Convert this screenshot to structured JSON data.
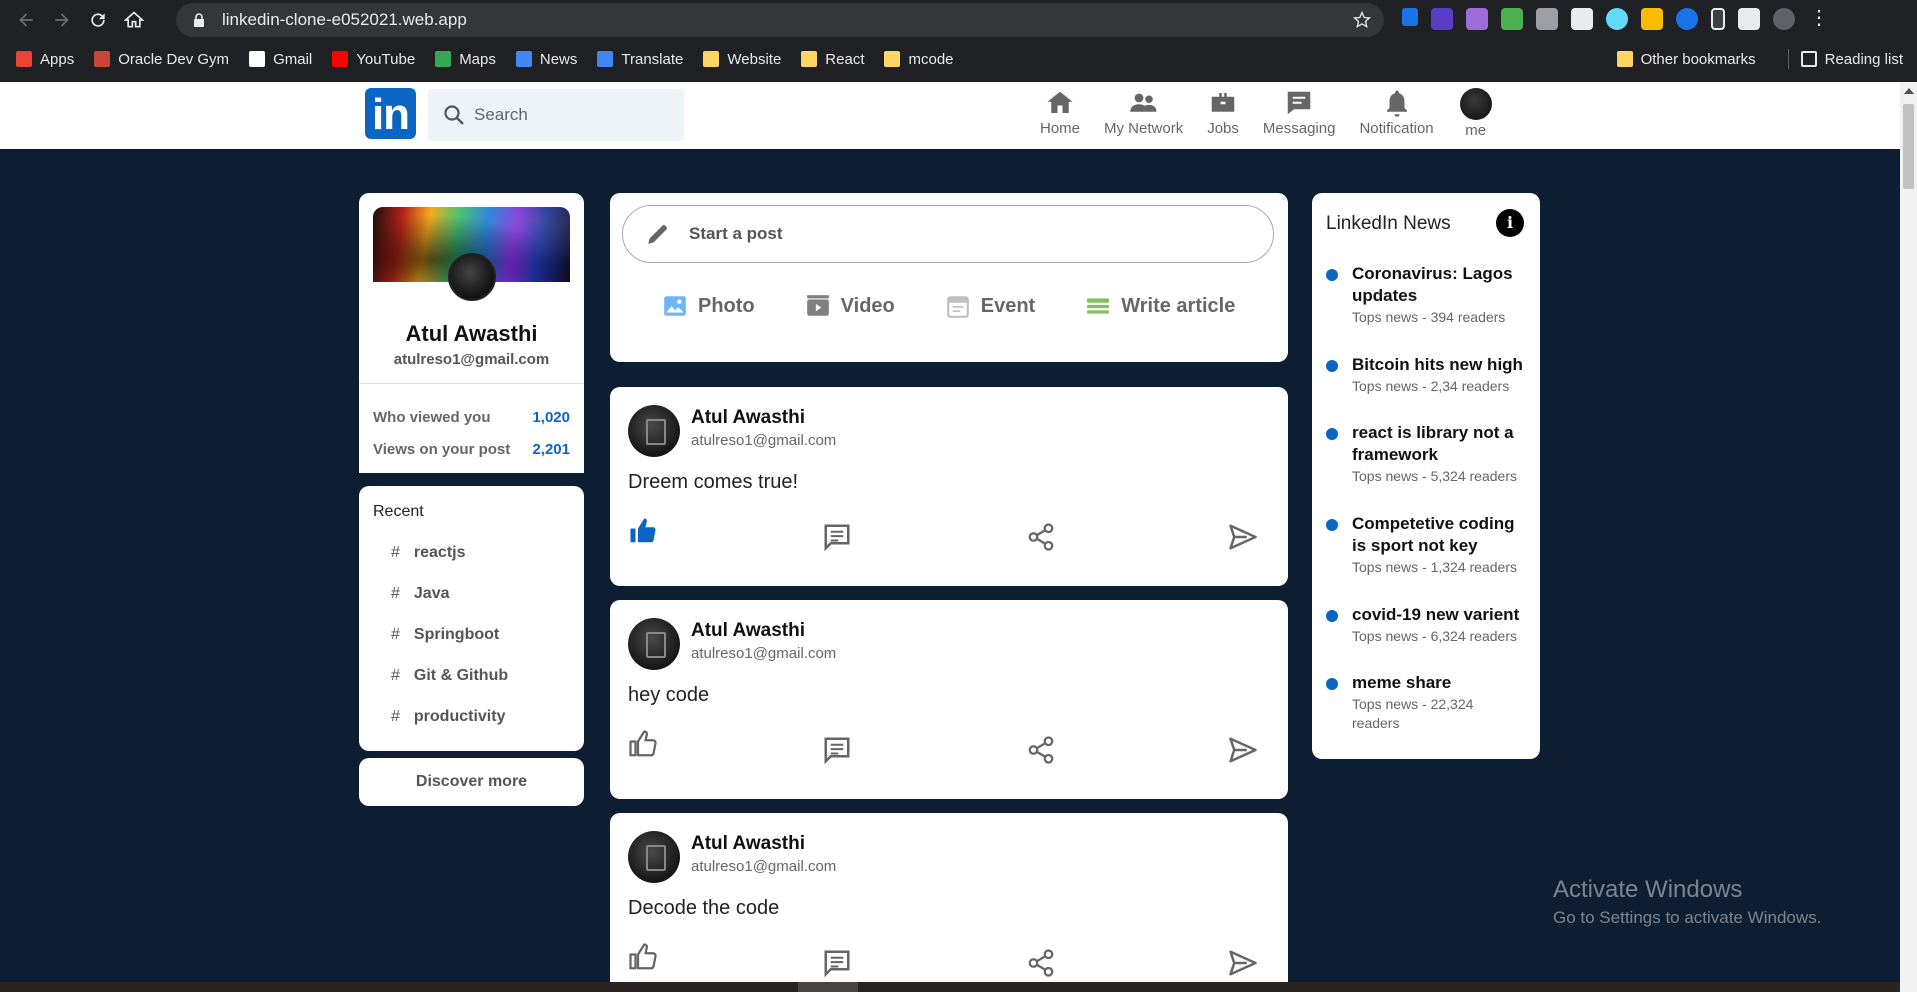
{
  "browser": {
    "url": "linkedin-clone-e052021.web.app",
    "bookmarks": [
      {
        "label": "Apps",
        "color": "#ea4335"
      },
      {
        "label": "Oracle Dev Gym",
        "color": "#c74634"
      },
      {
        "label": "Gmail",
        "color": "#ffffff"
      },
      {
        "label": "YouTube",
        "color": "#ff0000"
      },
      {
        "label": "Maps",
        "color": "#34a853"
      },
      {
        "label": "News",
        "color": "#4285f4"
      },
      {
        "label": "Translate",
        "color": "#4285f4"
      },
      {
        "label": "Website",
        "color": "#fdd663"
      },
      {
        "label": "React",
        "color": "#fdd663"
      },
      {
        "label": "mcode",
        "color": "#fdd663"
      }
    ],
    "other_bookmarks": "Other bookmarks",
    "reading_list": "Reading list"
  },
  "header": {
    "logo": "in",
    "search_placeholder": "Search",
    "nav": [
      {
        "label": "Home",
        "icon": "home-icon"
      },
      {
        "label": "My Network",
        "icon": "network-icon"
      },
      {
        "label": "Jobs",
        "icon": "briefcase-icon"
      },
      {
        "label": "Messaging",
        "icon": "message-icon"
      },
      {
        "label": "Notification",
        "icon": "bell-icon"
      },
      {
        "label": "me",
        "icon": "avatar"
      }
    ]
  },
  "profile": {
    "name": "Atul Awasthi",
    "email": "atulreso1@gmail.com",
    "stats": [
      {
        "label": "Who viewed you",
        "value": "1,020"
      },
      {
        "label": "Views on your post",
        "value": "2,201"
      }
    ]
  },
  "recent": {
    "title": "Recent",
    "items": [
      "reactjs",
      "Java",
      "Springboot",
      "Git & Github",
      "productivity"
    ],
    "hash": "#"
  },
  "discover": "Discover more",
  "composer": {
    "placeholder": "Start a post",
    "actions": [
      {
        "label": "Photo",
        "color": "#70b5f9"
      },
      {
        "label": "Video",
        "color": "#7f7f7f"
      },
      {
        "label": "Event",
        "color": "#c0c0c0"
      },
      {
        "label": "Write article",
        "color": "#7fc15e"
      }
    ]
  },
  "posts": [
    {
      "name": "Atul Awasthi",
      "email": "atulreso1@gmail.com",
      "text": "Dreem comes true!",
      "liked": true
    },
    {
      "name": "Atul Awasthi",
      "email": "atulreso1@gmail.com",
      "text": "hey code",
      "liked": false
    },
    {
      "name": "Atul Awasthi",
      "email": "atulreso1@gmail.com",
      "text": "Decode the code",
      "liked": false
    }
  ],
  "news": {
    "title": "LinkedIn News",
    "info_glyph": "i",
    "items": [
      {
        "headline": "Coronavirus: Lagos updates",
        "sub": "Tops news - 394 readers"
      },
      {
        "headline": "Bitcoin hits new high",
        "sub": "Tops news - 2,34 readers"
      },
      {
        "headline": "react is library not a framework",
        "sub": "Tops news - 5,324 readers"
      },
      {
        "headline": "Competetive coding is sport not key",
        "sub": "Tops news - 1,324 readers"
      },
      {
        "headline": "covid-19 new varient",
        "sub": "Tops news - 6,324 readers"
      },
      {
        "headline": "meme share",
        "sub": "Tops news - 22,324 readers"
      }
    ]
  },
  "watermark": {
    "line1": "Activate Windows",
    "line2": "Go to Settings to activate Windows."
  },
  "colors": {
    "brand": "#0a66c2",
    "page_bg": "#0d1e33"
  }
}
